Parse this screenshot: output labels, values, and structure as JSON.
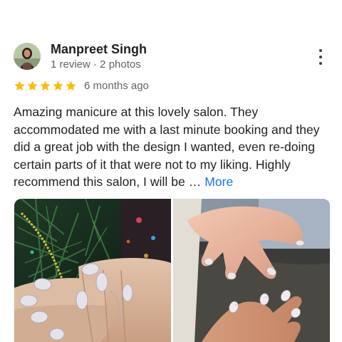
{
  "reviewer": {
    "name": "Manpreet Singh",
    "meta": "1 review · 2 photos"
  },
  "rating": {
    "stars": 5,
    "max": 5,
    "date": "6 months ago",
    "star_color": "#fbbc04"
  },
  "review": {
    "text": "Amazing manicure at this lovely salon. They accommodated me with a last minute booking and they did a great job with the design I wanted, even re-doing certain parts of it that were not to my liking. Highly recommend this salon, I will be …",
    "more_label": "More",
    "link_color": "#1a73e8"
  },
  "menu": {
    "icon": "more-vert-icon"
  },
  "photos": [
    {
      "subject": "manicured hands near christmas tree"
    },
    {
      "subject": "manicured hands on table"
    }
  ]
}
